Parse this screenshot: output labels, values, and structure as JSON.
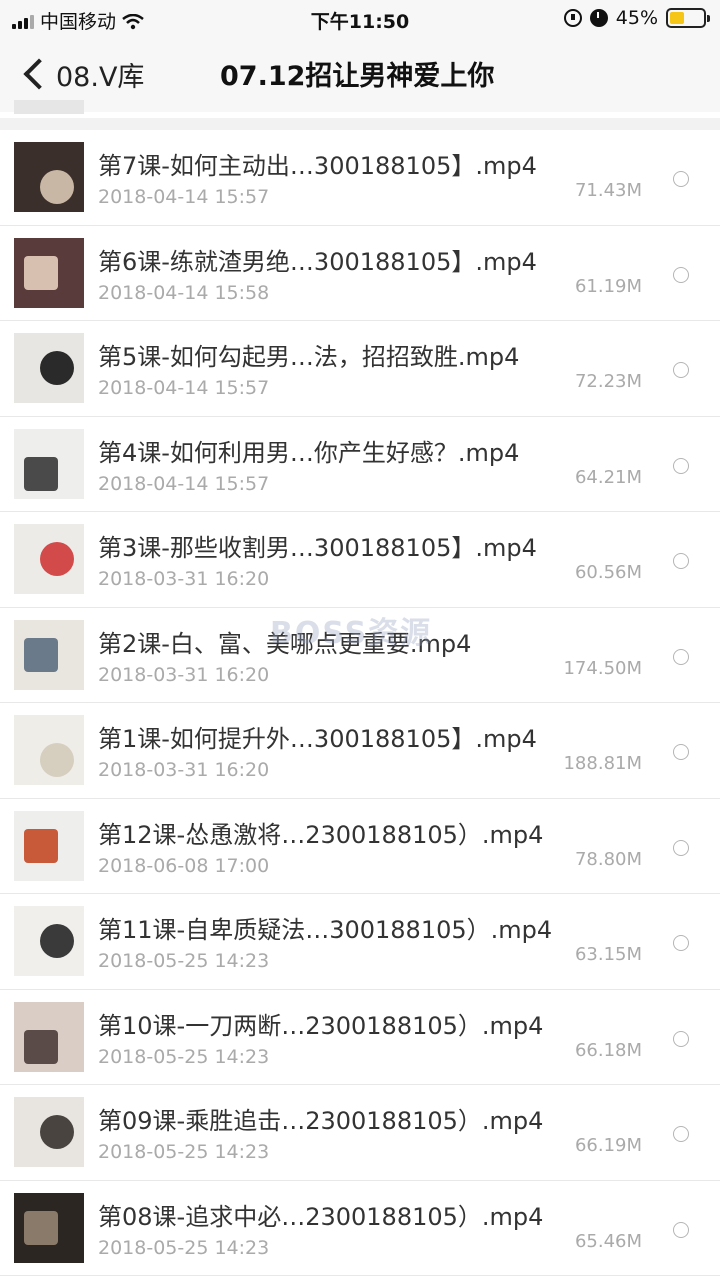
{
  "status_bar": {
    "carrier": "中国移动",
    "time": "下午11:50",
    "battery": "45%",
    "battery_level": 0.45
  },
  "nav": {
    "back_label": "08.V库",
    "title": "07.12招让男神爱上你"
  },
  "watermark": "BOSS资源",
  "files": [
    {
      "name": "第7课-如何主动出…300188105】.mp4",
      "date": "2018-04-14 15:57",
      "size": "71.43M",
      "thumb_colors": [
        "#3a2f2a",
        "#c9b7a5"
      ]
    },
    {
      "name": "第6课-练就渣男绝…300188105】.mp4",
      "date": "2018-04-14 15:58",
      "size": "61.19M",
      "thumb_colors": [
        "#5a3b3b",
        "#d8c0b0"
      ]
    },
    {
      "name": "第5课-如何勾起男…法，招招致胜.mp4",
      "date": "2018-04-14 15:57",
      "size": "72.23M",
      "thumb_colors": [
        "#e8e6e2",
        "#2a2a2a"
      ]
    },
    {
      "name": "第4课-如何利用男…你产生好感？.mp4",
      "date": "2018-04-14 15:57",
      "size": "64.21M",
      "thumb_colors": [
        "#eeeeec",
        "#4a4a4a"
      ]
    },
    {
      "name": "第3课-那些收割男…300188105】.mp4",
      "date": "2018-03-31 16:20",
      "size": "60.56M",
      "thumb_colors": [
        "#ecebe8",
        "#d24a4a"
      ]
    },
    {
      "name": "第2课-白、富、美哪点更重要.mp4",
      "date": "2018-03-31 16:20",
      "size": "174.50M",
      "thumb_colors": [
        "#e9e6e0",
        "#6b7a8a"
      ]
    },
    {
      "name": "第1课-如何提升外…300188105】.mp4",
      "date": "2018-03-31 16:20",
      "size": "188.81M",
      "thumb_colors": [
        "#efede8",
        "#d6cfc0"
      ]
    },
    {
      "name": "第12课-怂恿激将…2300188105）.mp4",
      "date": "2018-06-08 17:00",
      "size": "78.80M",
      "thumb_colors": [
        "#eeeeec",
        "#c85a3a"
      ]
    },
    {
      "name": "第11课-自卑质疑法…300188105）.mp4",
      "date": "2018-05-25 14:23",
      "size": "63.15M",
      "thumb_colors": [
        "#f0efec",
        "#3a3a3a"
      ]
    },
    {
      "name": "第10课-一刀两断…2300188105）.mp4",
      "date": "2018-05-25 14:23",
      "size": "66.18M",
      "thumb_colors": [
        "#d9cdc6",
        "#5a4a48"
      ]
    },
    {
      "name": "第09课-乘胜追击…2300188105）.mp4",
      "date": "2018-05-25 14:23",
      "size": "66.19M",
      "thumb_colors": [
        "#e8e5e0",
        "#4a4440"
      ]
    },
    {
      "name": "第08课-追求中必…2300188105）.mp4",
      "date": "2018-05-25 14:23",
      "size": "65.46M",
      "thumb_colors": [
        "#2b2622",
        "#8a7a6a"
      ]
    }
  ]
}
